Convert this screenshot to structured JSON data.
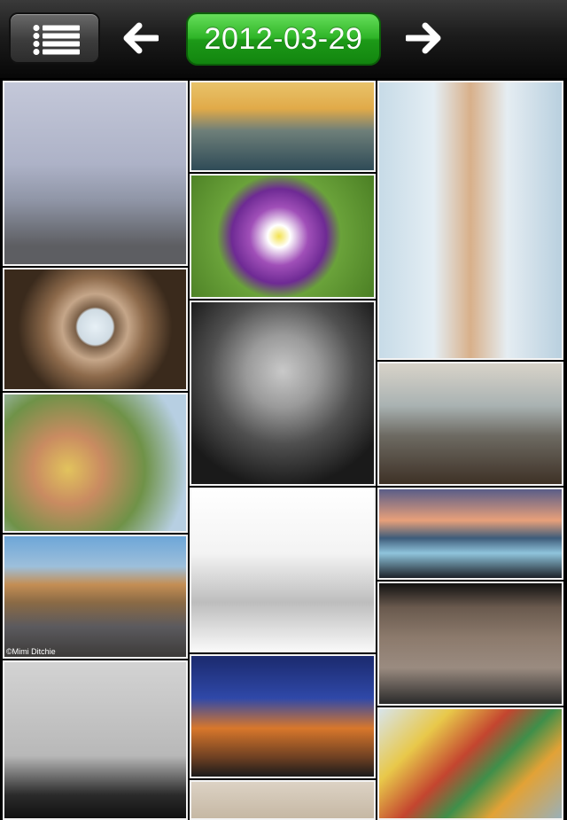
{
  "toolbar": {
    "date": "2012-03-29",
    "menu_icon": "list-icon",
    "prev_icon": "arrow-left-icon",
    "next_icon": "arrow-right-icon"
  },
  "tiles": {
    "col1": [
      {
        "name": "photo-violinist-on-beach",
        "bg": "linear-gradient(#c4c8d9 0%, #adb2c7 45%, #8f95a6 65%, #5d5e62 90%)"
      },
      {
        "name": "photo-dome-ceiling",
        "bg": "radial-gradient(circle at 50% 48%, #e7f0f6 0%, #cfdbe3 16%, #7a5f47 18%, #c5a689 30%, #8d6a4b 45%, #3a2a1c 70%)"
      },
      {
        "name": "photo-orchids",
        "bg": "radial-gradient(circle at 35% 55%, #e2c35d 0%, #c98b61 25%, #6f9248 55%, #b7cfe2 85%)"
      },
      {
        "name": "photo-beach-sunset",
        "bg": "linear-gradient(#6da6d8 0%, #9dbfdb 25%, #c48e54 40%, #8a6a45 55%, #5b5a5e 75%, #3d3b39 100%)",
        "caption": "©Mimi Ditchie"
      },
      {
        "name": "photo-gateway-arch",
        "bg": "linear-gradient(#d3d3d3 0%, #b8b8b8 60%, #2b2b2b 85%, #111 100%)"
      }
    ],
    "col2": [
      {
        "name": "photo-city-skyline",
        "bg": "linear-gradient(#e8c36a 0%, #e1aa49 30%, #6e7f79 55%, #2f4b57 100%)"
      },
      {
        "name": "photo-purple-pansy",
        "bg": "radial-gradient(circle at 48% 50%, #f3e24f 0%, #fff 10%, #a04fb8 26%, #6e2a94 42%, #6aa23a 55%, #4b7f24 100%)"
      },
      {
        "name": "photo-old-man-portrait",
        "bg": "radial-gradient(circle at 50% 38%, #c9c9c9 0%, #9a9a9a 25%, #505050 50%, #1a1a1a 80%)"
      },
      {
        "name": "photo-twins-witch-hats",
        "bg": "linear-gradient(#ffffff 0%, #f3f3f3 40%, #bdbdbd 70%, #f8f8f8 100%)"
      },
      {
        "name": "photo-night-fantasy-scene",
        "bg": "linear-gradient(#1b2a6e 0%, #2f48a8 35%, #d8772b 60%, #6a3e22 85%, #1a1a1a 100%)"
      },
      {
        "name": "photo-partial-bottom",
        "bg": "linear-gradient(#dcd2c4, #c6b8a4)"
      }
    ],
    "col3": [
      {
        "name": "photo-girl-with-guitar",
        "bg": "linear-gradient(90deg, #c7dbe7 0%, #e4eef4 30%, #d8b08a 50%, #e5edf2 70%, #b9d0df 100%)"
      },
      {
        "name": "photo-children-with-deer",
        "bg": "linear-gradient(#d8d3c9 0%, #a9b2b2 35%, #6d6a62 60%, #3e3126 100%)"
      },
      {
        "name": "photo-iceberg-beach",
        "bg": "linear-gradient(#5a5d88 0%, #e8a07a 35%, #3e5c7a 55%, #8fc4dc 72%, #1d2229 100%)"
      },
      {
        "name": "photo-city-street",
        "bg": "linear-gradient(#111 0%, #6a5a4e 20%, #8c7a6c 45%, #9a8b80 70%, #2a2a2a 100%)"
      },
      {
        "name": "photo-colorful-quilt",
        "bg": "linear-gradient(135deg, #d8e4ea 0%, #e8c84a 25%, #c4452f 45%, #3f8f4a 60%, #e2a236 75%, #9ab0b8 100%)"
      }
    ]
  }
}
